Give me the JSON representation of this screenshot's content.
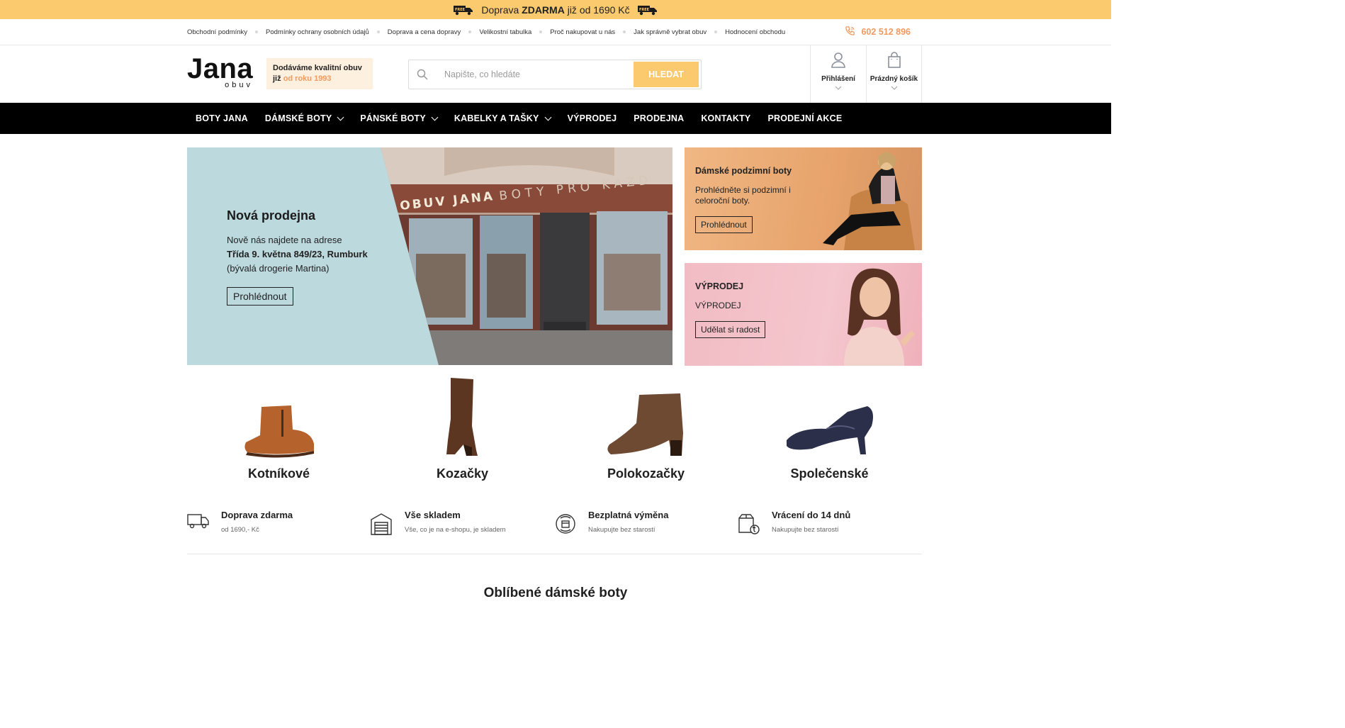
{
  "promo": {
    "prefix": "Doprava",
    "strong": "ZDARMA",
    "suffix": "již od 1690 Kč",
    "badge": "FREE"
  },
  "utility": {
    "links": [
      "Obchodní podmínky",
      "Podmínky ochrany osobních údajů",
      "Doprava a cena dopravy",
      "Velikostní tabulka",
      "Proč nakupovat u nás",
      "Jak správně vybrat obuv",
      "Hodnocení obchodu"
    ],
    "phone": "602 512 896"
  },
  "header": {
    "logo_big": "Jana",
    "logo_small": "obuv",
    "slogan_line1": "Dodáváme kvalitní obuv",
    "slogan_prefix": "již",
    "slogan_accent": "od roku 1993",
    "search_placeholder": "Napište, co hledáte",
    "search_button": "HLEDAT",
    "login_label": "Přihlášení",
    "cart_label": "Prázdný košík"
  },
  "nav": [
    {
      "label": "BOTY JANA",
      "dropdown": false
    },
    {
      "label": "DÁMSKÉ BOTY",
      "dropdown": true
    },
    {
      "label": "PÁNSKÉ BOTY",
      "dropdown": true
    },
    {
      "label": "KABELKY A TAŠKY",
      "dropdown": true
    },
    {
      "label": "VÝPRODEJ",
      "dropdown": false
    },
    {
      "label": "PRODEJNA",
      "dropdown": false
    },
    {
      "label": "KONTAKTY",
      "dropdown": false
    },
    {
      "label": "PRODEJNÍ AKCE",
      "dropdown": false
    }
  ],
  "hero": {
    "title": "Nová prodejna",
    "line1": "Nově nás najdete na adrese",
    "line2": "Třída 9. května 849/23, Rumburk",
    "line3": "(bývalá drogerie Martina)",
    "button": "Prohlédnout",
    "sign_left": "OBUV JANA",
    "sign_right": "BOTY PRO KAŽD"
  },
  "side1": {
    "title": "Dámské podzimní boty",
    "text": "Prohlédněte si podzimní i celoroční boty.",
    "button": "Prohlédnout"
  },
  "side2": {
    "title": "VÝPRODEJ",
    "text": "VÝPRODEJ",
    "button": "Udělat si radost"
  },
  "categories": [
    "Kotníkové",
    "Kozačky",
    "Polokozačky",
    "Společenské"
  ],
  "benefits": [
    {
      "title": "Doprava zdarma",
      "desc": "od 1690,- Kč",
      "icon": "truck-icon"
    },
    {
      "title": "Vše skladem",
      "desc": "Vše, co je na e-shopu, je skladem",
      "icon": "warehouse-icon"
    },
    {
      "title": "Bezplatná výměna",
      "desc": "Nakupujte bez starostí",
      "icon": "exchange-icon"
    },
    {
      "title": "Vrácení do 14 dnů",
      "desc": "Nakupujte bez starostí",
      "icon": "return-box-icon"
    }
  ],
  "section_title": "Oblíbené dámské boty",
  "colors": {
    "accent": "#fbca6f",
    "orange": "#f29a5e",
    "nav_bg": "#000000",
    "hero_bg": "#bcd9de"
  }
}
